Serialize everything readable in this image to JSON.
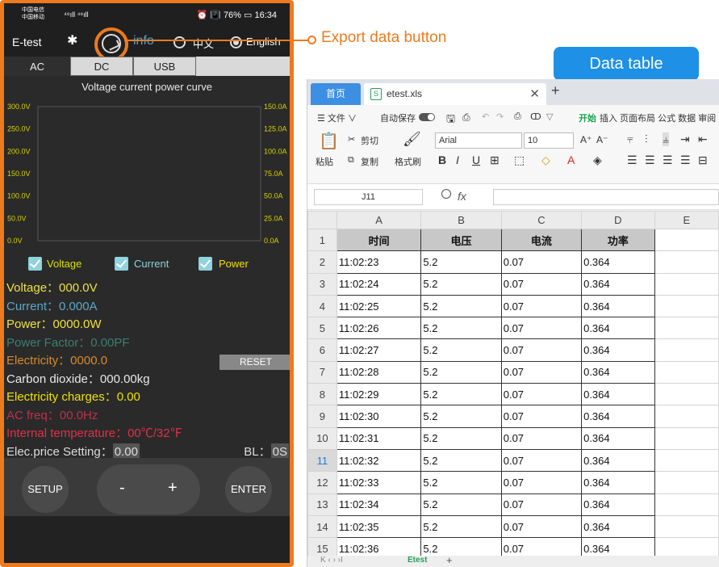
{
  "phone": {
    "status": {
      "carrier1": "中国电信",
      "carrier2": "中国移动",
      "signal": "⁴⁶ıll ⁴⁶ıll",
      "right": "⏰ 📳 76% ▭ 16:34"
    },
    "app_title": "E-test",
    "info_label": "info",
    "lang_cn": "中文",
    "lang_en": "English",
    "selected_language": "English",
    "tabs": [
      {
        "label": "AC",
        "active": true
      },
      {
        "label": "DC",
        "active": false
      },
      {
        "label": "USB",
        "active": false
      }
    ],
    "chart_data": {
      "type": "line",
      "title": "Voltage current power curve",
      "left_axis_ticks": [
        "300.0V",
        "250.0V",
        "200.0V",
        "150.0V",
        "100.0V",
        "50.0V",
        "0.0V"
      ],
      "right_axis_ticks": [
        "150.0A",
        "125.0A",
        "100.0A",
        "75.0A",
        "50.0A",
        "25.0A",
        "0.0A"
      ],
      "ylim_left": [
        0,
        300
      ],
      "ylim_right": [
        0,
        150
      ],
      "series": [],
      "grid": true
    },
    "checkboxes": [
      {
        "label": "Voltage",
        "checked": true,
        "color": "#d9e000"
      },
      {
        "label": "Current",
        "checked": true,
        "color": "#8fd3dc"
      },
      {
        "label": "Power",
        "checked": true,
        "color": "#f0e000"
      }
    ],
    "readouts": [
      {
        "text": "Voltage：000.0V",
        "color": "#f0e040"
      },
      {
        "text": "Current：0.000A",
        "color": "#5aa9c8"
      },
      {
        "text": "Power：0000.0W",
        "color": "#f0e040"
      },
      {
        "text": "Power Factor：0.00PF",
        "color": "#3b7f6e"
      },
      {
        "text": "Electricity：0000.0",
        "color": "#d98a2a"
      },
      {
        "text": "Carbon dioxide：000.00kg",
        "color": "#e8e8e8"
      },
      {
        "text": "Electricity charges：0.00",
        "color": "#f0e000"
      },
      {
        "text": "AC freq：00.0Hz",
        "color": "#c0304a"
      },
      {
        "text": "Internal temperature：00℃/32℉",
        "color": "#e0304a"
      }
    ],
    "price_label": "Elec.price Setting：",
    "price_value": "0.00",
    "bl_label": "BL：",
    "bl_value": "0S",
    "reset_label": "RESET",
    "setup_label": "SETUP",
    "minus_label": "-",
    "plus_label": "+",
    "enter_label": "ENTER"
  },
  "annotations": {
    "export_button": "Export data button",
    "data_table": "Data table",
    "accent": "#ee7a1e",
    "badge_color": "#1e90e6"
  },
  "sheet": {
    "home_tab": "首页",
    "file_tab": "etest.xls",
    "file_icon": "S",
    "menu": {
      "file": "☰ 文件 ∨",
      "autosave": "自动保存",
      "start": "开始",
      "items": "插入 页面布局 公式 数据 审阅"
    },
    "ribbon": {
      "paste": "粘贴",
      "cut": "剪切",
      "copy": "复制",
      "format_painter": "格式刷",
      "font": "Arial",
      "size": "10"
    },
    "name_box": "J11",
    "fx": "fx",
    "columns": [
      "A",
      "B",
      "C",
      "D",
      "E"
    ],
    "headers": [
      "时间",
      "电压",
      "电流",
      "功率"
    ],
    "rows": [
      [
        "11:02:23",
        "5.2",
        "0.07",
        "0.364"
      ],
      [
        "11:02:24",
        "5.2",
        "0.07",
        "0.364"
      ],
      [
        "11:02:25",
        "5.2",
        "0.07",
        "0.364"
      ],
      [
        "11:02:26",
        "5.2",
        "0.07",
        "0.364"
      ],
      [
        "11:02:27",
        "5.2",
        "0.07",
        "0.364"
      ],
      [
        "11:02:28",
        "5.2",
        "0.07",
        "0.364"
      ],
      [
        "11:02:29",
        "5.2",
        "0.07",
        "0.364"
      ],
      [
        "11:02:30",
        "5.2",
        "0.07",
        "0.364"
      ],
      [
        "11:02:31",
        "5.2",
        "0.07",
        "0.364"
      ],
      [
        "11:02:32",
        "5.2",
        "0.07",
        "0.364"
      ],
      [
        "11:02:33",
        "5.2",
        "0.07",
        "0.364"
      ],
      [
        "11:02:34",
        "5.2",
        "0.07",
        "0.364"
      ],
      [
        "11:02:35",
        "5.2",
        "0.07",
        "0.364"
      ],
      [
        "11:02:36",
        "5.2",
        "0.07",
        "0.364"
      ]
    ],
    "selected_row": 11,
    "sheet_tab": "Etest"
  }
}
